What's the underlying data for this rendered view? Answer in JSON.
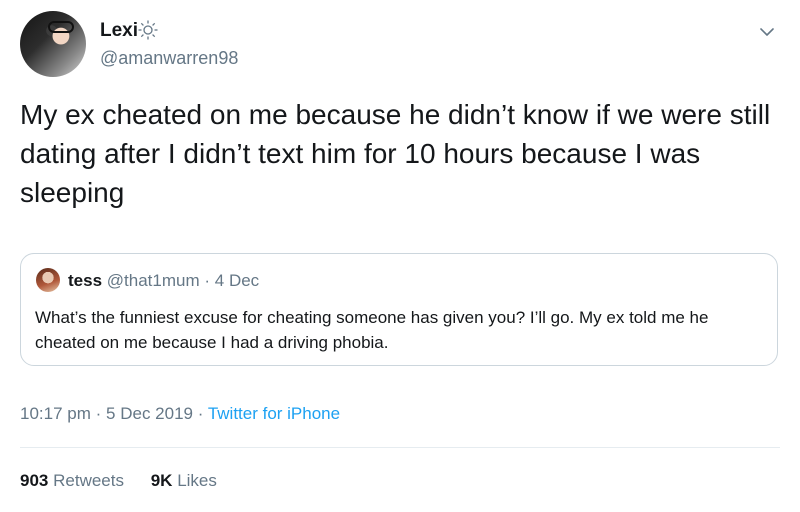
{
  "author": {
    "display_name": "Lexi",
    "handle": "@amanwarren98",
    "avatar_icon": "profile-photo",
    "badge_icon": "sun-outline-icon",
    "menu_icon": "chevron-down-icon"
  },
  "tweet": {
    "text": "My ex cheated on me because he didn’t know if we were still dating after I didn’t text him for 10 hours because I was sleeping"
  },
  "quoted_tweet": {
    "display_name": "tess",
    "handle": "@that1mum",
    "separator": "·",
    "date": "4 Dec",
    "text": "What’s the funniest excuse for cheating someone has given you? I’ll go. My ex told me he cheated on me because I had a driving phobia."
  },
  "meta": {
    "time": "10:17 pm",
    "separator": "·",
    "date": "5 Dec 2019",
    "separator2": "·",
    "source": "Twitter for iPhone"
  },
  "stats": {
    "retweets_count": "903",
    "retweets_label": "Retweets",
    "likes_count": "9K",
    "likes_label": "Likes"
  },
  "colors": {
    "text": "#14171a",
    "secondary": "#657786",
    "link": "#1da1f2",
    "border": "#ccd6dd"
  }
}
